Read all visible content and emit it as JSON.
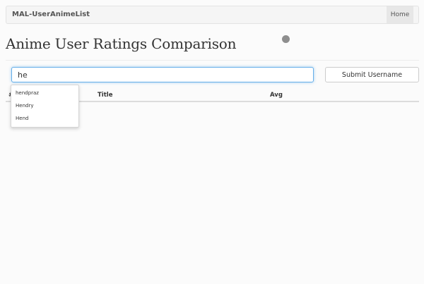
{
  "navbar": {
    "brand": "MAL-UserAnimeList",
    "home_label": "Home"
  },
  "page_title": "Anime User Ratings Comparison",
  "search": {
    "value": "he",
    "placeholder": ""
  },
  "submit_label": "Submit Username",
  "table": {
    "columns": [
      "#",
      "Title",
      "Avg"
    ]
  },
  "autocomplete": {
    "items": [
      "hendpraz",
      "Hendry",
      "Hend"
    ]
  },
  "colors": {
    "focus_border": "#66afe9",
    "navbar_bg": "#f5f5f5",
    "loading_dot": "#8e8e8e"
  }
}
